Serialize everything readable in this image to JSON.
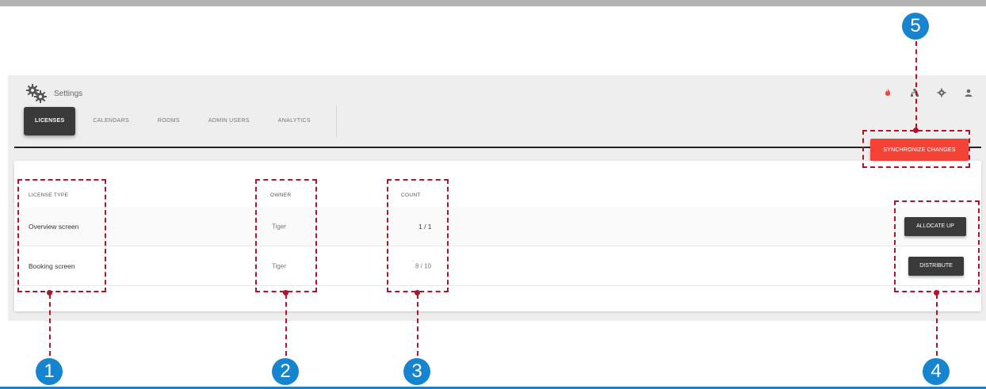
{
  "header": {
    "title": "Settings",
    "icons": [
      "flame-icon",
      "network-icon",
      "gear-icon",
      "user-icon"
    ],
    "accent_color": "#f44336"
  },
  "tabs": [
    {
      "label": "LICENSES",
      "active": true
    },
    {
      "label": "CALENDARS",
      "active": false
    },
    {
      "label": "ROOMS",
      "active": false
    },
    {
      "label": "ADMIN USERS",
      "active": false
    },
    {
      "label": "ANALYTICS",
      "active": false
    }
  ],
  "sync_button": {
    "label": "SYNCHRONIZE CHANGES",
    "color": "#f44336"
  },
  "table": {
    "columns": [
      "LICENSE TYPE",
      "OWNER",
      "COUNT"
    ],
    "rows": [
      {
        "license_type": "Overview screen",
        "owner": "Tiger",
        "count": "1 / 1",
        "action": "ALLOCATE UP"
      },
      {
        "license_type": "Booking screen",
        "owner": "Tiger",
        "count": "8 / 10",
        "action": "DISTRIBUTE"
      }
    ]
  },
  "callouts": [
    "1",
    "2",
    "3",
    "4",
    "5"
  ],
  "callout_color": "#b3122a",
  "badge_color": "#1784cf"
}
